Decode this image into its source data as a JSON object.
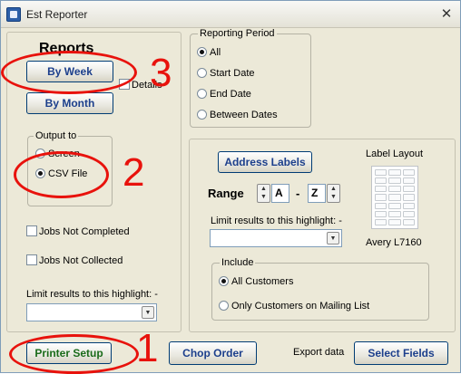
{
  "window": {
    "title": "Est Reporter",
    "close_glyph": "✕"
  },
  "reports": {
    "legend": "Reports",
    "by_week_label": "By Week",
    "by_month_label": "By Month",
    "details_label": "Details"
  },
  "output_to": {
    "legend": "Output to",
    "options": [
      {
        "label": "Screen",
        "selected": false
      },
      {
        "label": "CSV File",
        "selected": true
      }
    ]
  },
  "filters": {
    "jobs_not_completed": "Jobs Not Completed",
    "jobs_not_collected": "Jobs Not Collected",
    "highlight_label": "Limit results to this highlight: -",
    "highlight_value": ""
  },
  "reporting_period": {
    "legend": "Reporting Period",
    "options": [
      {
        "label": "All",
        "selected": true
      },
      {
        "label": "Start Date",
        "selected": false
      },
      {
        "label": "End Date",
        "selected": false
      },
      {
        "label": "Between Dates",
        "selected": false
      }
    ]
  },
  "address_labels": {
    "button_label": "Address Labels",
    "range_label": "Range",
    "range_from": "A",
    "range_dash": "-",
    "range_to": "Z",
    "highlight_label": "Limit results to this highlight: -",
    "highlight_value": "",
    "label_layout_label": "Label Layout",
    "label_model": "Avery L7160",
    "include_legend": "Include",
    "include_options": [
      {
        "label": "All Customers",
        "selected": true
      },
      {
        "label": "Only Customers on Mailing List",
        "selected": false
      }
    ]
  },
  "footer": {
    "printer_setup_label": "Printer Setup",
    "chop_order_label": "Chop Order",
    "export_data_label": "Export data",
    "select_fields_label": "Select Fields"
  },
  "annotations": {
    "mark_1": "1",
    "mark_2": "2",
    "mark_3": "3",
    "color": "#e8120c"
  },
  "icons": {
    "app": "est-reporter-app-icon",
    "combo": "chevron-down-icon",
    "spin": "spin-up-down-icon"
  }
}
